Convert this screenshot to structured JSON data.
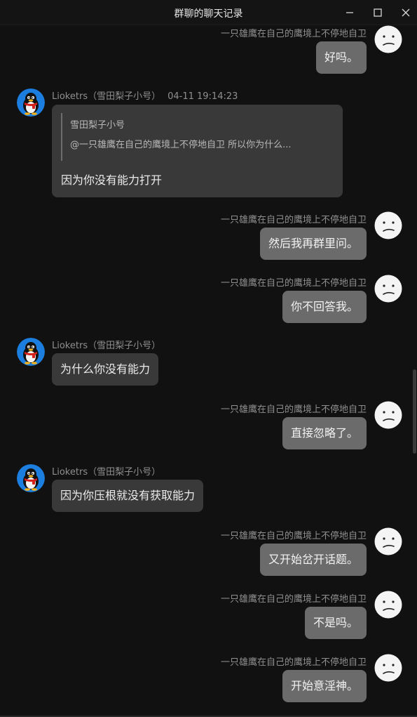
{
  "window": {
    "title": "群聊的聊天记录",
    "buttons": {
      "minimize": "minimize-icon",
      "maximize": "maximize-icon",
      "close": "close-icon"
    }
  },
  "colors": {
    "background": "#111111",
    "outgoing_bubble": "#6b6b6b",
    "incoming_bubble": "#393939",
    "sender_text": "#8f8f8f"
  },
  "messages": [
    {
      "sender": "一只雄鹰在自己的鹰境上不停地自卫",
      "text": "好吗。"
    },
    {
      "sender": "Lioketrs（雪田梨子小号）",
      "time": "04-11 19:14:23",
      "quote": {
        "name": "雪田梨子小号",
        "text": "@一只雄鹰在自己的鹰境上不停地自卫 所以你为什么..."
      },
      "text": "因为你没有能力打开"
    },
    {
      "sender": "一只雄鹰在自己的鹰境上不停地自卫",
      "text": "然后我再群里问。"
    },
    {
      "sender": "一只雄鹰在自己的鹰境上不停地自卫",
      "text": "你不回答我。"
    },
    {
      "sender": "Lioketrs（雪田梨子小号）",
      "text": "为什么你没有能力"
    },
    {
      "sender": "一只雄鹰在自己的鹰境上不停地自卫",
      "text": "直接忽略了。"
    },
    {
      "sender": "Lioketrs（雪田梨子小号）",
      "text": "因为你压根就没有获取能力"
    },
    {
      "sender": "一只雄鹰在自己的鹰境上不停地自卫",
      "text": "又开始岔开话题。"
    },
    {
      "sender": "一只雄鹰在自己的鹰境上不停地自卫",
      "text": "不是吗。"
    },
    {
      "sender": "一只雄鹰在自己的鹰境上不停地自卫",
      "text": "开始意淫神。"
    }
  ]
}
